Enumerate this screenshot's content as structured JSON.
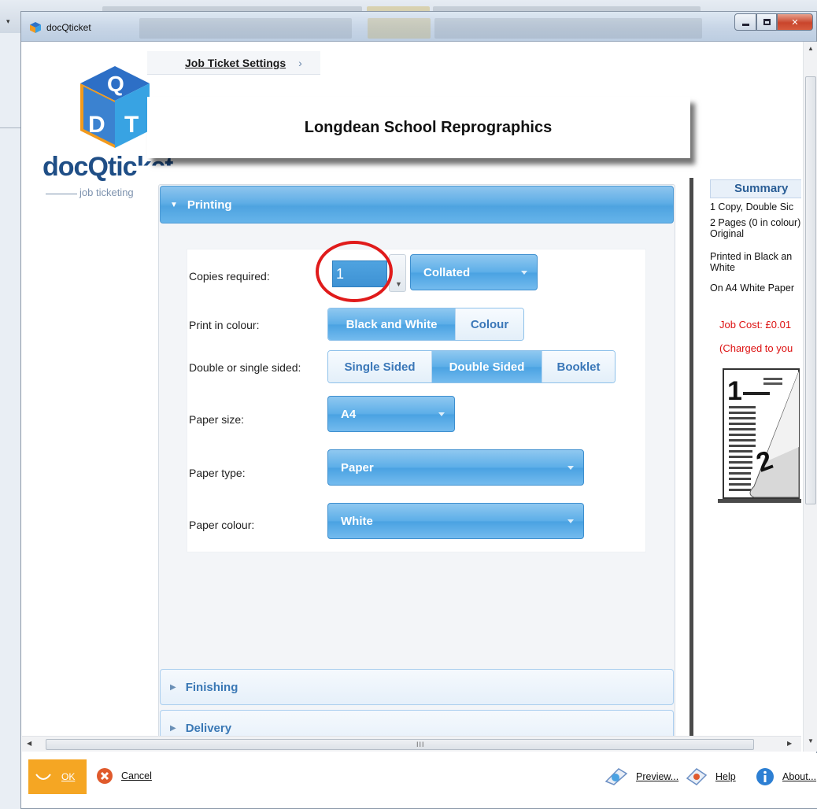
{
  "window": {
    "title": "docQticket"
  },
  "breadcrumb": {
    "label": "Job Ticket Settings",
    "arrow": "›"
  },
  "logo": {
    "text_a": "docQ",
    "text_b": "tic",
    "text_c": "ket",
    "subtitle": "job ticketing"
  },
  "header": {
    "organization": "Longdean School Reprographics"
  },
  "sections": {
    "printing": "Printing",
    "finishing": "Finishing",
    "delivery": "Delivery"
  },
  "form": {
    "copies_label": "Copies required:",
    "copies_value": "1",
    "collation": "Collated",
    "colour_label": "Print in colour:",
    "colour_options": [
      "Black and White",
      "Colour"
    ],
    "colour_selected": "Black and White",
    "sides_label": "Double or single sided:",
    "sides_options": [
      "Single Sided",
      "Double Sided",
      "Booklet"
    ],
    "sides_selected": "Double Sided",
    "paper_size_label": "Paper size:",
    "paper_size": "A4",
    "paper_type_label": "Paper type:",
    "paper_type": "Paper",
    "paper_colour_label": "Paper colour:",
    "paper_colour": "White"
  },
  "summary": {
    "title": "Summary",
    "line1": "1 Copy, Double Sic",
    "line2": "2 Pages (0 in colour) Original",
    "line3": "Printed in Black an White",
    "line4": "On A4 White Paper",
    "cost": "Job Cost: £0.01",
    "charged": "(Charged to you"
  },
  "actions": {
    "ok": "OK",
    "cancel": "Cancel",
    "preview": "Preview...",
    "help": "Help",
    "about": "About..."
  },
  "icons": {
    "app": "docqticket-cube-icon",
    "cancel": "cancel-x-icon",
    "preview": "preview-icon",
    "help": "help-icon",
    "about": "info-icon"
  },
  "colors": {
    "accent_blue": "#5caee8",
    "ok_orange": "#f5a623",
    "cost_red": "#dd1111",
    "highlight_circle": "#e01b1b"
  }
}
